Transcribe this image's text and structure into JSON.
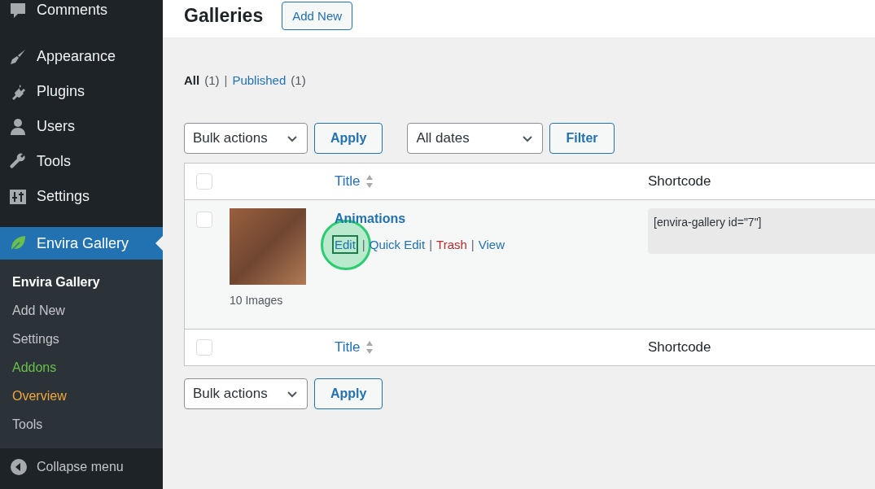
{
  "sidebar": {
    "menu": [
      {
        "label": "Comments",
        "kind": "comment",
        "selected": false
      },
      {
        "label": "Appearance",
        "kind": "brush",
        "selected": false
      },
      {
        "label": "Plugins",
        "kind": "plug",
        "selected": false
      },
      {
        "label": "Users",
        "kind": "user",
        "selected": false
      },
      {
        "label": "Tools",
        "kind": "wrench",
        "selected": false
      },
      {
        "label": "Settings",
        "kind": "sliders",
        "selected": false
      },
      {
        "label": "Envira Gallery",
        "kind": "leaf",
        "selected": true
      }
    ],
    "submenu": [
      {
        "label": "Envira Gallery",
        "selected": true,
        "color": "#ffffff"
      },
      {
        "label": "Add New",
        "selected": false,
        "color": "#c3c4c7"
      },
      {
        "label": "Settings",
        "selected": false,
        "color": "#c3c4c7"
      },
      {
        "label": "Addons",
        "selected": false,
        "color": "#6bc04b"
      },
      {
        "label": "Overview",
        "selected": false,
        "color": "#f0a83a"
      },
      {
        "label": "Tools",
        "selected": false,
        "color": "#c3c4c7"
      }
    ],
    "collapse": "Collapse menu"
  },
  "page_title": "Galleries",
  "add_new_button": "Add New",
  "views": [
    {
      "label": "All",
      "count": "(1)",
      "selected": true
    },
    {
      "label": "Published",
      "count": "(1)",
      "selected": false
    }
  ],
  "view_separator": "|",
  "top_toolbar": {
    "bulk_select": "Bulk actions",
    "apply": "Apply",
    "date_select": "All dates",
    "filter": "Filter"
  },
  "table": {
    "header": {
      "checked": false,
      "columns": [
        "Title",
        "Shortcode"
      ]
    },
    "rows": [
      {
        "checked": false,
        "title": "Animations",
        "image_count": "10 Images",
        "shortcode": "[envira-gallery id=\"7\"]",
        "actions": [
          {
            "label": "Edit",
            "kind": "normal",
            "highlighted": true
          },
          {
            "label": "Quick Edit",
            "kind": "normal",
            "highlighted": false
          },
          {
            "label": "Trash",
            "kind": "delete",
            "highlighted": false
          },
          {
            "label": "View",
            "kind": "normal",
            "highlighted": false
          }
        ]
      }
    ],
    "action_separator": "|",
    "footer": {
      "checked": false,
      "columns": [
        "Title",
        "Shortcode"
      ]
    }
  },
  "bottom_toolbar": {
    "bulk_select": "Bulk actions",
    "apply": "Apply"
  }
}
